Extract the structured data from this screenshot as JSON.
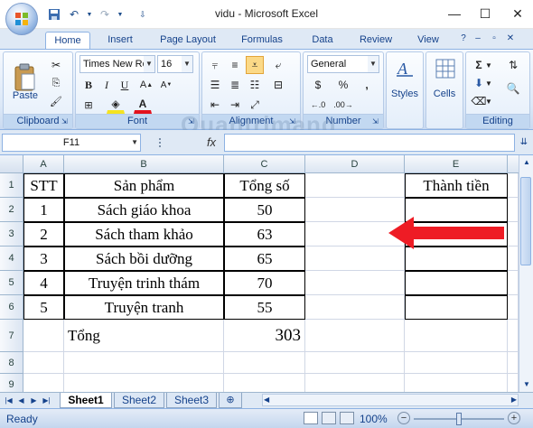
{
  "window": {
    "title": "vidu - Microsoft Excel"
  },
  "ribbon": {
    "tabs": [
      "Home",
      "Insert",
      "Page Layout",
      "Formulas",
      "Data",
      "Review",
      "View"
    ],
    "active_tab": "Home",
    "groups": {
      "clipboard": {
        "label": "Clipboard",
        "paste_label": "Paste"
      },
      "font": {
        "label": "Font",
        "font_name": "Times New Ro",
        "font_size": "16"
      },
      "alignment": {
        "label": "Alignment"
      },
      "number": {
        "label": "Number",
        "format": "General",
        "currency": "$",
        "percent": "%",
        "comma": ","
      },
      "styles": {
        "label": "Styles"
      },
      "cells": {
        "label": "Cells"
      },
      "editing": {
        "label": "Editing"
      }
    }
  },
  "formula_bar": {
    "name_box": "F11",
    "fx": "fx",
    "formula": ""
  },
  "sheet": {
    "columns": [
      "A",
      "B",
      "C",
      "D",
      "E"
    ],
    "rows": [
      "1",
      "2",
      "3",
      "4",
      "5",
      "6",
      "7",
      "8",
      "9"
    ],
    "headers": {
      "stt": "STT",
      "product": "Sản phẩm",
      "total": "Tổng số",
      "amount": "Thành tiền"
    },
    "data": [
      {
        "stt": "1",
        "product": "Sách giáo khoa",
        "total": "50"
      },
      {
        "stt": "2",
        "product": "Sách tham khảo",
        "total": "63"
      },
      {
        "stt": "3",
        "product": "Sách bồi dưỡng",
        "total": "65"
      },
      {
        "stt": "4",
        "product": "Truyện trinh thám",
        "total": "70"
      },
      {
        "stt": "5",
        "product": "Truyện tranh",
        "total": "55"
      }
    ],
    "sum_label": "Tổng",
    "sum_value": "303"
  },
  "sheet_tabs": [
    "Sheet1",
    "Sheet2",
    "Sheet3"
  ],
  "active_sheet": "Sheet1",
  "status": {
    "text": "Ready",
    "zoom": "100%"
  },
  "watermark": "Quantrimang",
  "colors": {
    "accent": "#15428b",
    "arrow": "#ee1c25",
    "ribbon": "#dce8f7"
  }
}
